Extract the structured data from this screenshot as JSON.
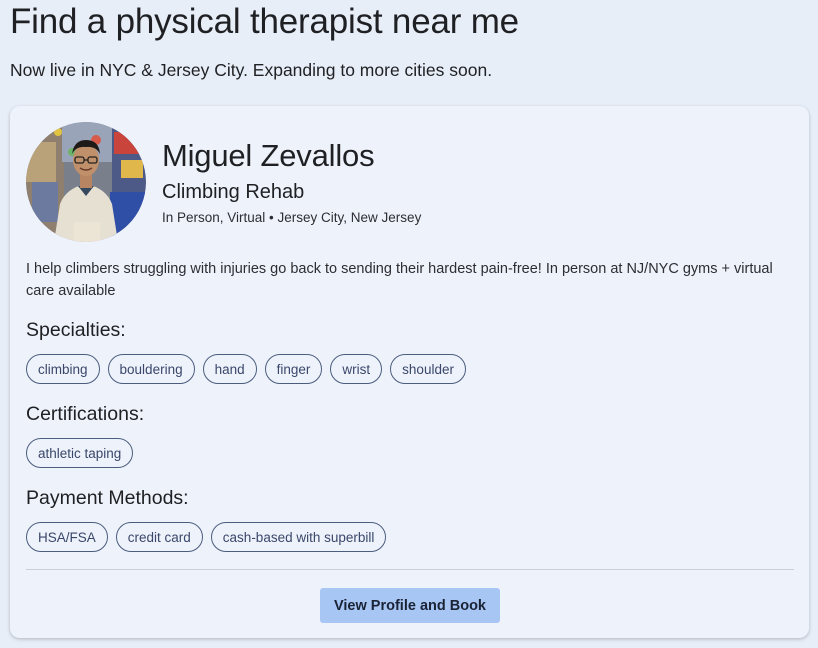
{
  "header": {
    "title": "Find a physical therapist near me",
    "subtitle": "Now live in NYC & Jersey City. Expanding to more cities soon."
  },
  "therapist": {
    "name": "Miguel Zevallos",
    "practice": "Climbing Rehab",
    "meta": "In Person, Virtual • Jersey City, New Jersey",
    "bio": "I help climbers struggling with injuries go back to sending their hardest pain-free! In person at NJ/NYC gyms + virtual care available",
    "avatar_icon": "profile-photo"
  },
  "sections": {
    "specialties": {
      "heading": "Specialties:",
      "tags": [
        "climbing",
        "bouldering",
        "hand",
        "finger",
        "wrist",
        "shoulder"
      ]
    },
    "certifications": {
      "heading": "Certifications:",
      "tags": [
        "athletic taping"
      ]
    },
    "payment": {
      "heading": "Payment Methods:",
      "tags": [
        "HSA/FSA",
        "credit card",
        "cash-based with superbill"
      ]
    }
  },
  "actions": {
    "cta_label": "View Profile and Book"
  },
  "colors": {
    "page_bg": "#e8eef8",
    "card_bg": "#eef2fb",
    "button_bg": "#a8c6f4",
    "tag_border": "#4b5d7e"
  }
}
